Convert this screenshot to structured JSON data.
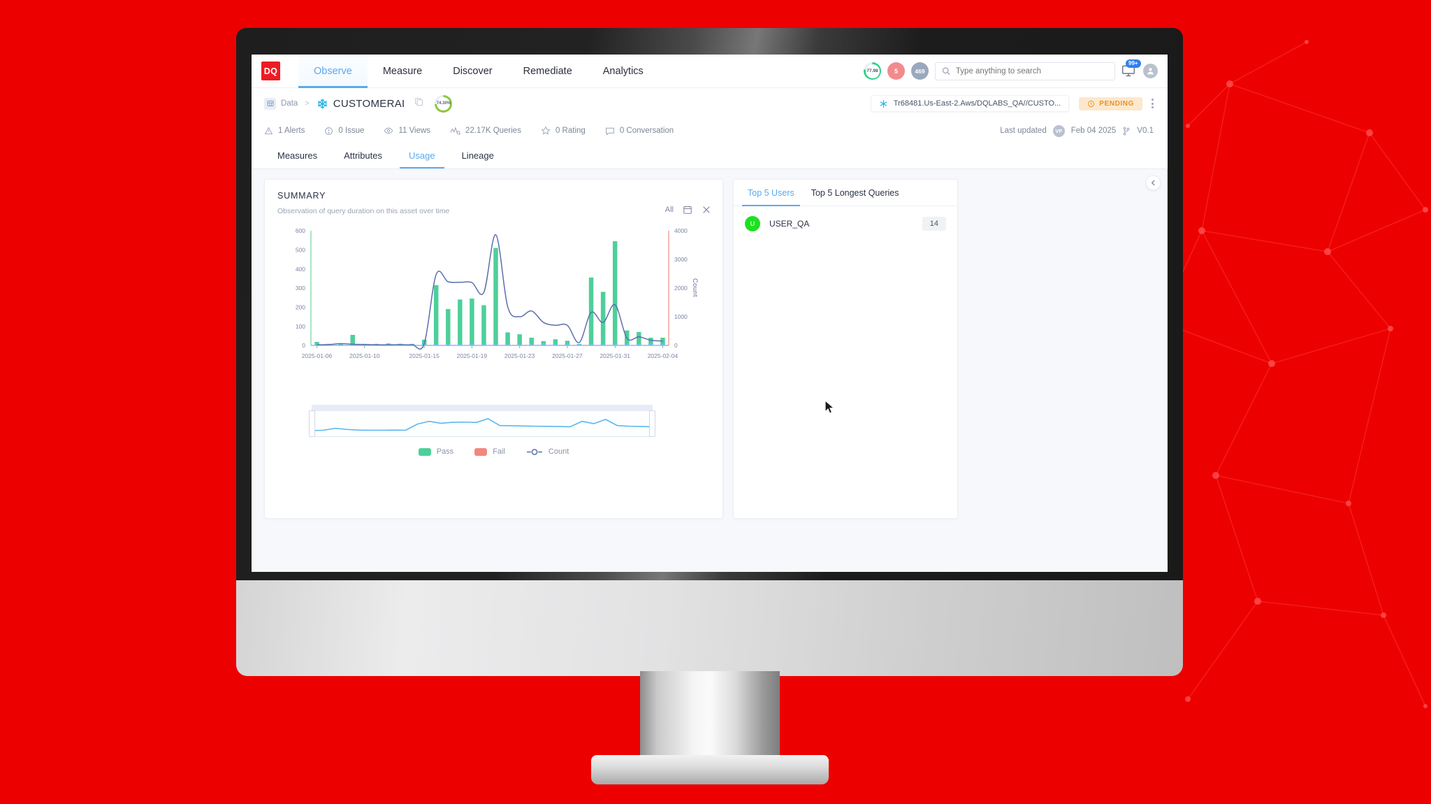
{
  "app": {
    "logo_text": "DQ",
    "nav": [
      {
        "label": "Observe",
        "active": true
      },
      {
        "label": "Measure",
        "active": false
      },
      {
        "label": "Discover",
        "active": false
      },
      {
        "label": "Remediate",
        "active": false
      },
      {
        "label": "Analytics",
        "active": false
      }
    ],
    "header_right": {
      "score": "77.98",
      "alert_count": "5",
      "info_count": "469",
      "notification_count": "99+"
    },
    "search": {
      "placeholder": "Type anything to search",
      "value": ""
    }
  },
  "breadcrumb": {
    "root": "Data",
    "separator": ">",
    "asset": "CUSTOMERAI",
    "score_percent": "74.30%",
    "connection": "Tr68481.Us-East-2.Aws/DQLABS_QA//CUSTO...",
    "status": "PENDING"
  },
  "stats": [
    {
      "label": "1 Alerts",
      "icon": "warning-triangle-icon"
    },
    {
      "label": "0 Issue",
      "icon": "exclamation-circle-icon"
    },
    {
      "label": "11 Views",
      "icon": "eye-icon"
    },
    {
      "label": "22.17K Queries",
      "icon": "activity-icon"
    },
    {
      "label": "0 Rating",
      "icon": "star-icon"
    },
    {
      "label": "0 Conversation",
      "icon": "comment-icon"
    }
  ],
  "meta": {
    "last_updated_label": "Last updated",
    "editor_initials": "VP",
    "updated_date": "Feb 04 2025",
    "version": "V0.1"
  },
  "tabs": [
    {
      "label": "Measures",
      "active": false
    },
    {
      "label": "Attributes",
      "active": false
    },
    {
      "label": "Usage",
      "active": true
    },
    {
      "label": "Lineage",
      "active": false
    }
  ],
  "summary_card": {
    "title": "SUMMARY",
    "subtitle": "Observation of query duration on this asset over time",
    "action_all": "All",
    "calendar_icon": "calendar-icon",
    "close_icon": "close-icon"
  },
  "right_panel": {
    "tabs": [
      {
        "label": "Top 5 Users",
        "active": true
      },
      {
        "label": "Top 5 Longest Queries",
        "active": false
      }
    ],
    "users": [
      {
        "initial": "U",
        "name": "USER_QA",
        "count": "14",
        "color": "#1ee020"
      }
    ]
  },
  "colors": {
    "pass": "#4ECF9A",
    "fail": "#F3867F",
    "count_line": "#5B6FAE",
    "brush_line": "#5BB8EF",
    "accent": "#5aa9ee",
    "brand_red": "#ED1C24",
    "pending": "#E99324"
  },
  "chart_data": {
    "type": "bar",
    "title": "SUMMARY",
    "subtitle": "Observation of query duration on this asset over time",
    "xlabel": "",
    "ylabel": "",
    "y2label": "Count",
    "ylim": [
      0,
      600
    ],
    "y2lim": [
      0,
      4000
    ],
    "yticks": [
      0,
      100,
      200,
      300,
      400,
      500,
      600
    ],
    "y2ticks": [
      0,
      1000,
      2000,
      3000,
      4000
    ],
    "grid": false,
    "legend": [
      {
        "name": "Pass",
        "type": "bar",
        "color": "#4ECF9A"
      },
      {
        "name": "Fail",
        "type": "bar",
        "color": "#F3867F"
      },
      {
        "name": "Count",
        "type": "line",
        "color": "#5B6FAE"
      }
    ],
    "xtick_labels": [
      "2025-01-06",
      "2025-01-10",
      "2025-01-15",
      "2025-01-19",
      "2025-01-23",
      "2025-01-27",
      "2025-01-31",
      "2025-02-04"
    ],
    "categories": [
      "2025-01-06",
      "2025-01-07",
      "2025-01-08",
      "2025-01-09",
      "2025-01-10",
      "2025-01-11",
      "2025-01-12",
      "2025-01-13",
      "2025-01-14",
      "2025-01-15",
      "2025-01-16",
      "2025-01-17",
      "2025-01-18",
      "2025-01-19",
      "2025-01-20",
      "2025-01-21",
      "2025-01-22",
      "2025-01-23",
      "2025-01-24",
      "2025-01-25",
      "2025-01-26",
      "2025-01-27",
      "2025-01-28",
      "2025-01-29",
      "2025-01-30",
      "2025-01-31",
      "2025-02-01",
      "2025-02-02",
      "2025-02-03",
      "2025-02-04"
    ],
    "series": [
      {
        "name": "Pass",
        "color": "#4ECF9A",
        "axis": "left",
        "values": [
          18,
          4,
          0,
          55,
          2,
          0,
          10,
          8,
          0,
          30,
          315,
          190,
          240,
          245,
          210,
          510,
          68,
          58,
          40,
          22,
          32,
          24,
          0,
          355,
          280,
          545,
          78,
          70,
          40,
          40
        ]
      },
      {
        "name": "Fail",
        "color": "#F3867F",
        "axis": "left",
        "values": [
          0,
          0,
          0,
          0,
          0,
          0,
          0,
          0,
          0,
          0,
          0,
          0,
          0,
          0,
          0,
          0,
          0,
          0,
          0,
          0,
          0,
          0,
          0,
          0,
          0,
          0,
          0,
          0,
          0,
          0
        ]
      },
      {
        "name": "Count",
        "color": "#5B6FAE",
        "axis": "right",
        "values": [
          20,
          30,
          60,
          40,
          30,
          20,
          20,
          25,
          20,
          60,
          2470,
          2220,
          2200,
          2190,
          1850,
          3860,
          1350,
          1000,
          1200,
          800,
          700,
          700,
          100,
          1150,
          800,
          1420,
          250,
          300,
          180,
          150
        ]
      }
    ],
    "brush": {
      "type": "line",
      "color": "#5BB8EF",
      "values": [
        55,
        60,
        85,
        70,
        62,
        60,
        60,
        62,
        60,
        140,
        175,
        150,
        162,
        165,
        160,
        210,
        120,
        118,
        115,
        112,
        110,
        108,
        105,
        175,
        145,
        200,
        120,
        112,
        108,
        105
      ]
    }
  }
}
